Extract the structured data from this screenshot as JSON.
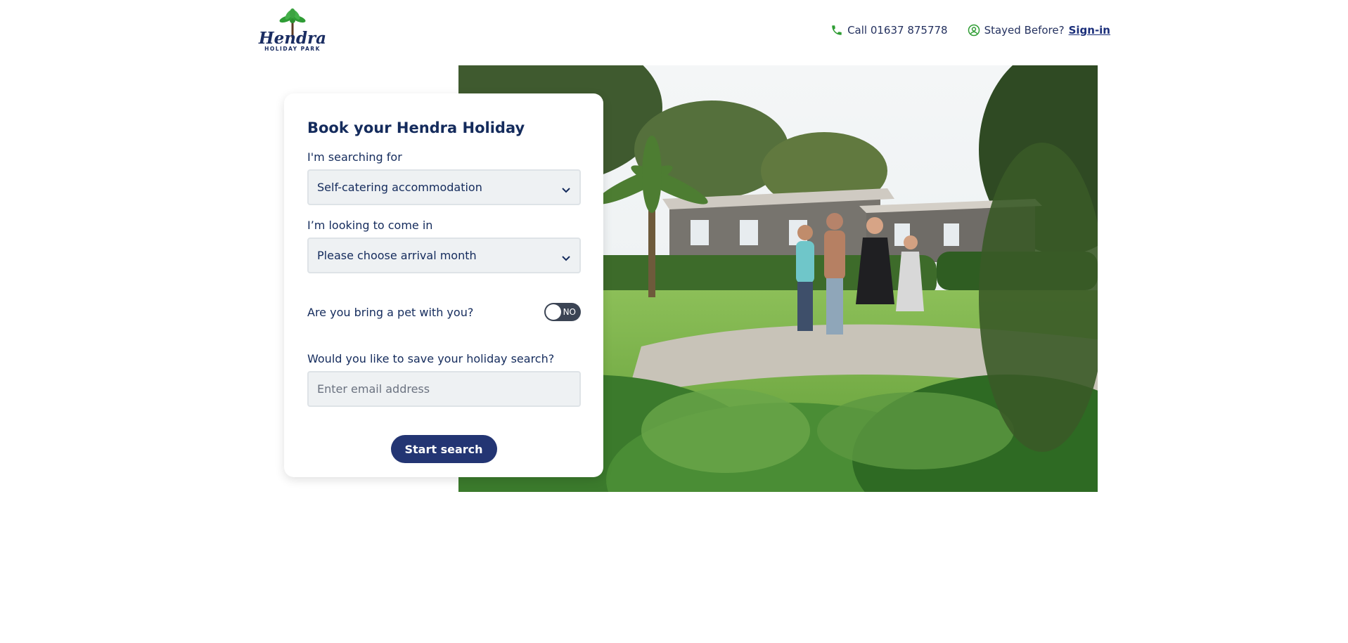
{
  "brand": {
    "logo_text": "Hendra",
    "logo_subtext": "HOLIDAY PARK"
  },
  "header": {
    "phone_icon": "phone-icon",
    "phone_label": "Call 01637 875778",
    "user_icon": "user-circle-icon",
    "stayed_before_label": "Stayed Before?",
    "signin_label": "Sign-in"
  },
  "booking": {
    "title": "Book your Hendra Holiday",
    "searching_label": "I'm searching for",
    "searching_value": "Self-catering accommodation",
    "month_label": "I’m looking to come in",
    "month_value": "Please choose arrival month",
    "pet_label": "Are you bring a pet with you?",
    "pet_toggle_text": "NO",
    "save_label": "Would you like to save your holiday search?",
    "email_placeholder": "Enter email address",
    "email_value": "",
    "start_button_label": "Start search"
  },
  "colors": {
    "navy": "#142b5c",
    "button": "#233573",
    "green_icon": "#2f9d34",
    "field_bg": "#eef1f3"
  }
}
